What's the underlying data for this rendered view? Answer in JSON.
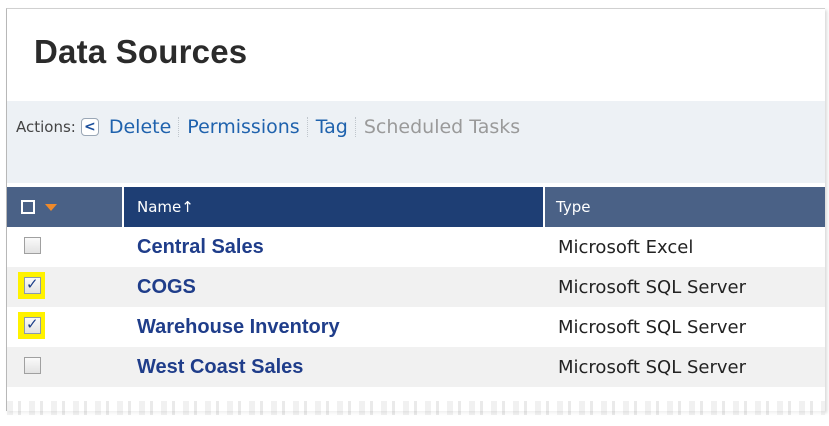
{
  "page": {
    "title": "Data Sources"
  },
  "actions": {
    "label": "Actions:",
    "items": [
      {
        "label": "Delete",
        "enabled": true
      },
      {
        "label": "Permissions",
        "enabled": true
      },
      {
        "label": "Tag",
        "enabled": true
      },
      {
        "label": "Scheduled Tasks",
        "enabled": false
      }
    ]
  },
  "table": {
    "columns": {
      "name": "Name↑",
      "type": "Type"
    },
    "rows": [
      {
        "name": "Central Sales",
        "type": "Microsoft Excel",
        "checked": false
      },
      {
        "name": "COGS",
        "type": "Microsoft SQL Server",
        "checked": true
      },
      {
        "name": "Warehouse Inventory",
        "type": "Microsoft SQL Server",
        "checked": true
      },
      {
        "name": "West Coast Sales",
        "type": "Microsoft SQL Server",
        "checked": false
      }
    ]
  },
  "colors": {
    "header_dark": "#1e3e74",
    "header_light": "#4a6186",
    "link": "#1f62ad",
    "highlight": "#fff200"
  }
}
